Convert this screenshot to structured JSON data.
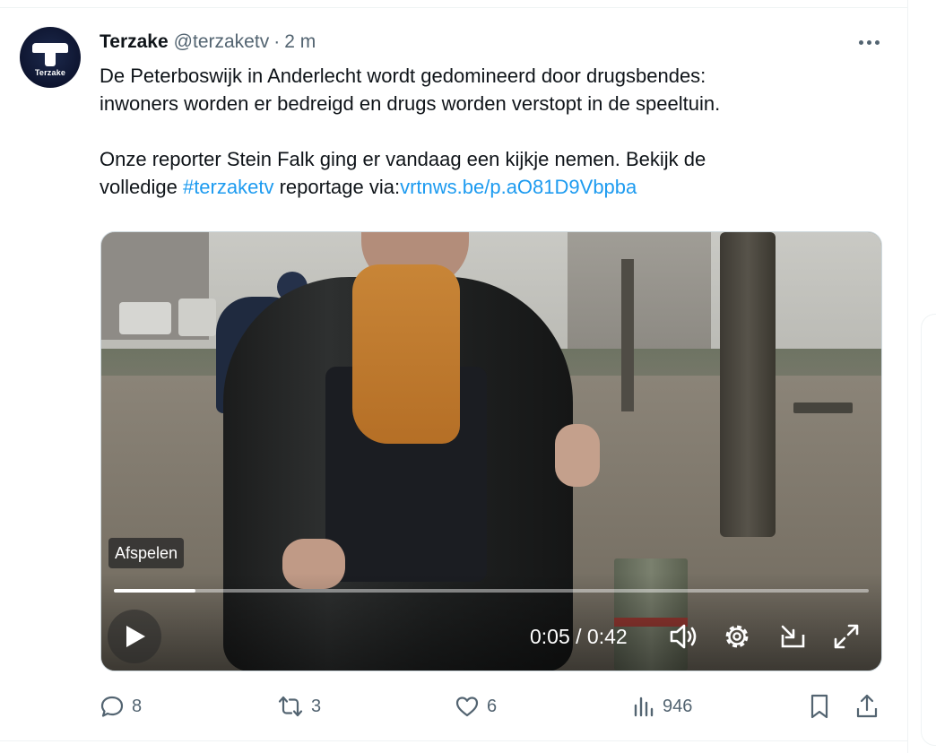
{
  "account": {
    "avatar_text": "Terzake",
    "name": "Terzake",
    "handle": "@terzaketv",
    "separator": "·",
    "time": "2 m"
  },
  "tweet": {
    "line1": "De Peterboswijk in Anderlecht wordt gedomineerd door drugsbendes:",
    "line2": "inwoners worden er bedreigd en drugs worden verstopt in de speeltuin.",
    "line3": "Onze reporter Stein Falk ging er vandaag een kijkje nemen. Bekijk de",
    "line4_pre": "volledige ",
    "hashtag": "#terzaketv",
    "line4_mid": " reportage via:",
    "url": "vrtnws.be/p.aO81D9Vbpba"
  },
  "video": {
    "tooltip": "Afspelen",
    "time_readout": "0:05 / 0:42",
    "progress_fraction": 0.108
  },
  "actions": {
    "replies": "8",
    "reposts": "3",
    "likes": "6",
    "views": "946"
  },
  "colors": {
    "link": "#1d9bf0",
    "secondary_text": "#536471",
    "scarf": "#c88537"
  },
  "icons": {
    "more": "more-horizontal-icon",
    "play": "play-icon",
    "volume": "volume-icon",
    "settings": "gear-icon",
    "popout": "popout-icon",
    "fullscreen": "fullscreen-icon",
    "reply": "reply-icon",
    "repost": "repost-icon",
    "like": "heart-icon",
    "views": "views-icon",
    "bookmark": "bookmark-icon",
    "share": "share-icon"
  }
}
